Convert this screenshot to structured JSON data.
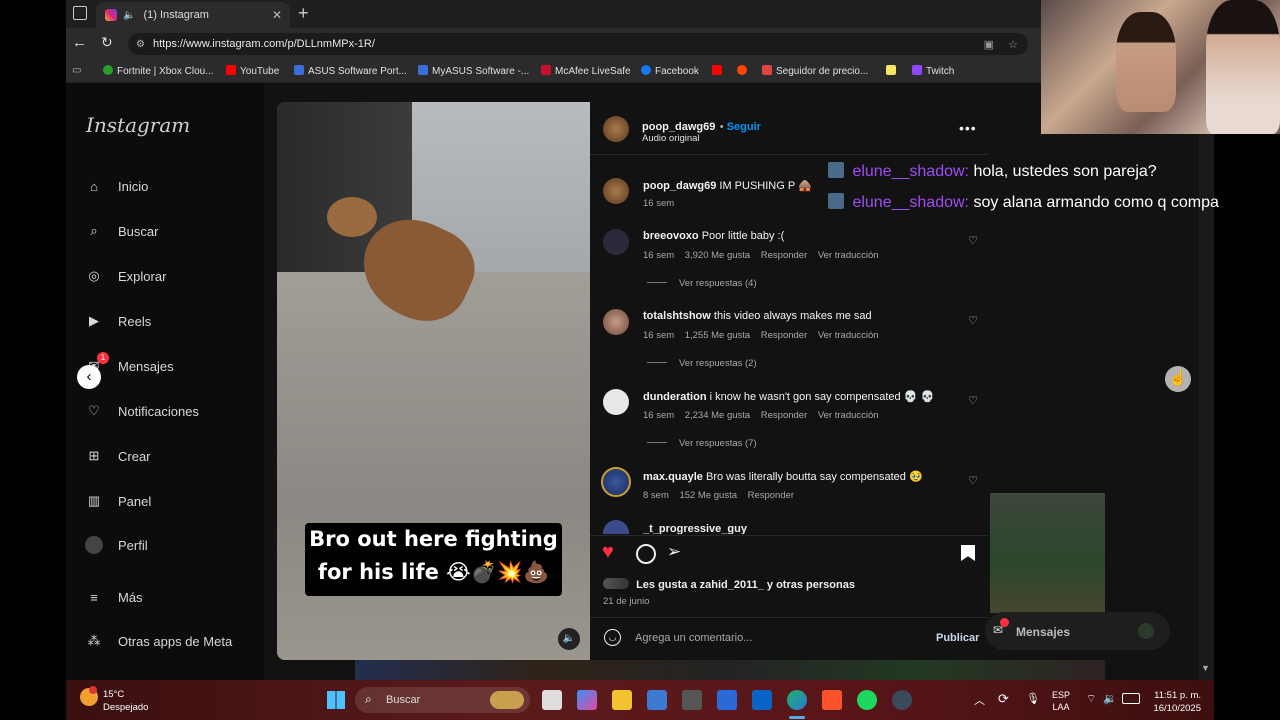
{
  "browser": {
    "tab_title": "(1) Instagram",
    "url": "https://www.instagram.com/p/DLLnmMPx-1R/",
    "bookmarks": [
      "Fortnite | Xbox Clou...",
      "YouTube",
      "ASUS Software Port...",
      "MyASUS Software -...",
      "McAfee LiveSafe",
      "Facebook",
      "Seguidor de precio...",
      "Twitch"
    ]
  },
  "sidebar": {
    "logo": "Instagram",
    "items": [
      {
        "label": "Inicio",
        "icon": "home-icon"
      },
      {
        "label": "Buscar",
        "icon": "search-icon"
      },
      {
        "label": "Explorar",
        "icon": "compass-icon"
      },
      {
        "label": "Reels",
        "icon": "reels-icon"
      },
      {
        "label": "Mensajes",
        "icon": "messenger-icon",
        "badge": "1"
      },
      {
        "label": "Notificaciones",
        "icon": "heart-icon"
      },
      {
        "label": "Crear",
        "icon": "plus-square-icon"
      },
      {
        "label": "Panel",
        "icon": "chart-icon"
      },
      {
        "label": "Perfil",
        "icon": "avatar-icon"
      },
      {
        "label": "Más",
        "icon": "menu-icon"
      },
      {
        "label": "Otras apps de Meta",
        "icon": "apps-icon"
      }
    ]
  },
  "video": {
    "caption_line1": "Bro out here fighting",
    "caption_line2": "for his life 😭💣💥💩"
  },
  "post": {
    "author": "poop_dawg69",
    "follow": "Seguir",
    "audio": "Audio original",
    "caption_user": "poop_dawg69",
    "caption_text": "IM PUSHING P 🛖",
    "caption_time": "16 sem",
    "comments": [
      {
        "user": "breeovoxo",
        "text": "Poor little baby :(",
        "time": "16 sem",
        "likes": "3,920 Me gusta",
        "reply": "Responder",
        "translate": "Ver traducción",
        "replies": "Ver respuestas (4)"
      },
      {
        "user": "totalshtshow",
        "text": "this video always makes me sad",
        "time": "16 sem",
        "likes": "1,255 Me gusta",
        "reply": "Responder",
        "translate": "Ver traducción",
        "replies": "Ver respuestas (2)"
      },
      {
        "user": "dunderation",
        "text": "i know he wasn't gon say compensated 💀 💀",
        "time": "16 sem",
        "likes": "2,234 Me gusta",
        "reply": "Responder",
        "translate": "Ver traducción",
        "replies": "Ver respuestas (7)"
      },
      {
        "user": "max.quayle",
        "text": "Bro was literally boutta say compensated 🥹",
        "time": "8 sem",
        "likes": "152 Me gusta",
        "reply": "Responder"
      },
      {
        "user": "_t_progressive_guy",
        "text": ""
      }
    ],
    "likes_text": "Les gusta a zahid_2011_ y otras personas",
    "date": "21 de junio",
    "comment_placeholder": "Agrega un comentario...",
    "publish": "Publicar"
  },
  "chat": [
    {
      "user": "elune__shadow:",
      "text": "hola, ustedes son pareja?"
    },
    {
      "user": "elune__shadow:",
      "text": "soy alana armando como q compa"
    }
  ],
  "messages_pill": "Mensajes",
  "taskbar": {
    "temp": "15°C",
    "weather": "Despejado",
    "search": "Buscar",
    "lang1": "ESP",
    "lang2": "LAA",
    "time": "11:51 p. m.",
    "date": "16/10/2025"
  },
  "colors": {
    "accent": "#0095f6",
    "like": "#ff3040",
    "chat_user": "#a04cf5"
  }
}
